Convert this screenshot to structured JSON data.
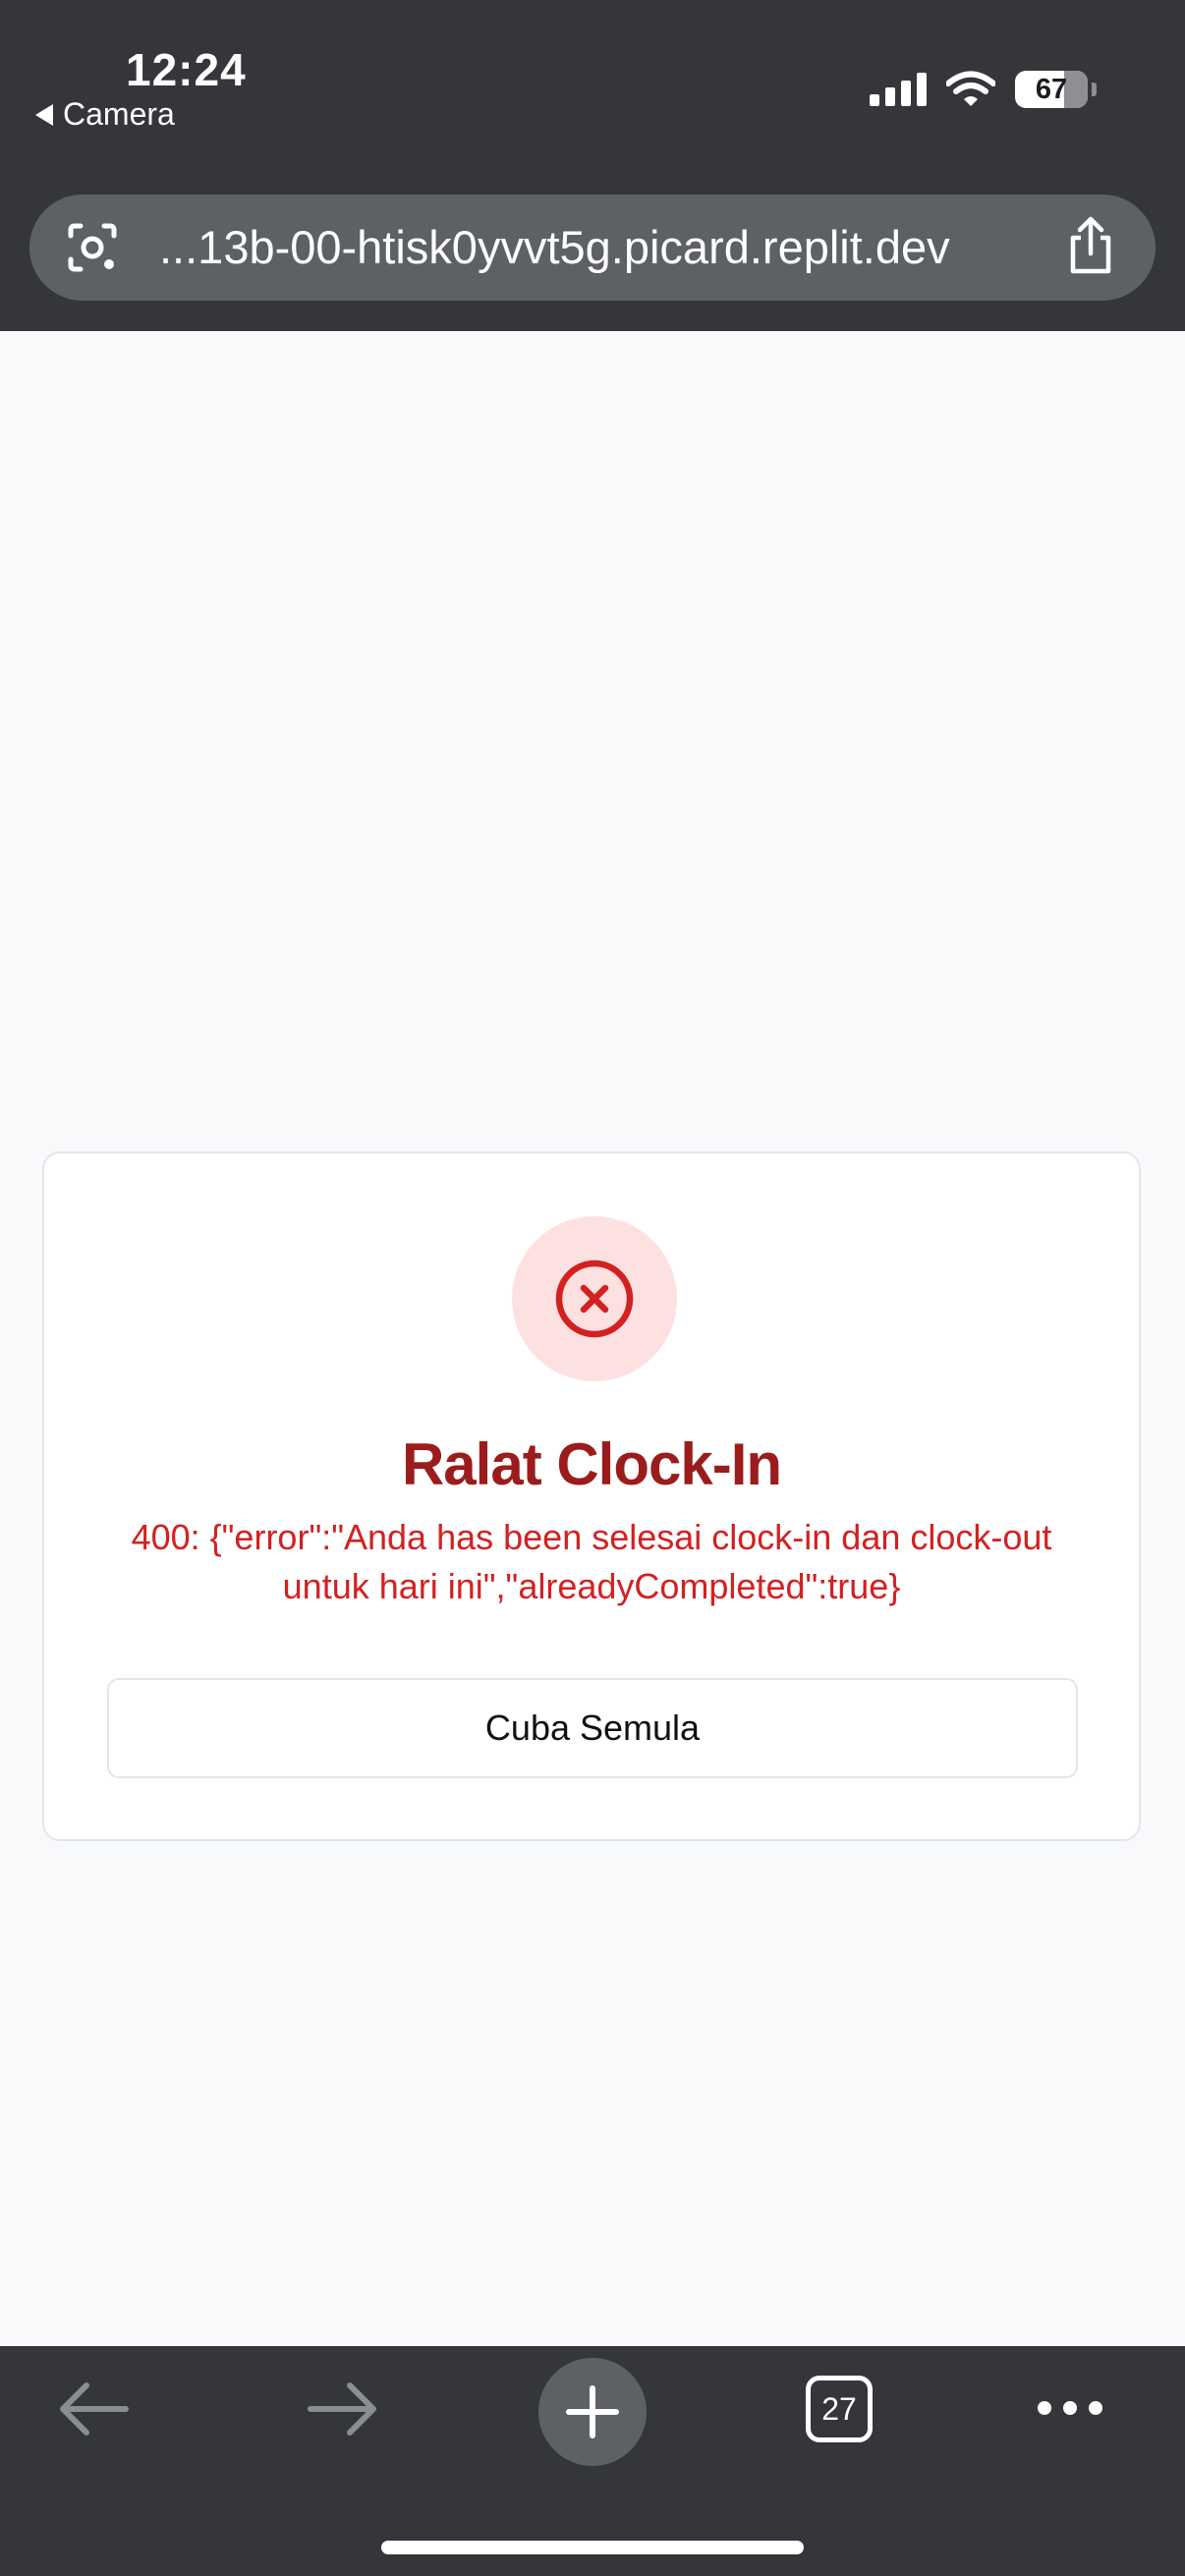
{
  "status_bar": {
    "time": "12:24",
    "back_app": "Camera",
    "battery": "67"
  },
  "browser": {
    "url": "...13b-00-htisk0yvvt5g.picard.replit.dev",
    "tab_count": "27"
  },
  "error_card": {
    "title": "Ralat Clock-In",
    "message": "400: {\"error\":\"Anda has been selesai clock-in dan clock-out untuk hari ini\",\"alreadyCompleted\":true}",
    "retry_label": "Cuba Semula"
  },
  "colors": {
    "chrome": "#34363a",
    "error_title": "#9b1c1c",
    "error_text": "#d42020",
    "error_badge_bg": "#fde1e1"
  }
}
